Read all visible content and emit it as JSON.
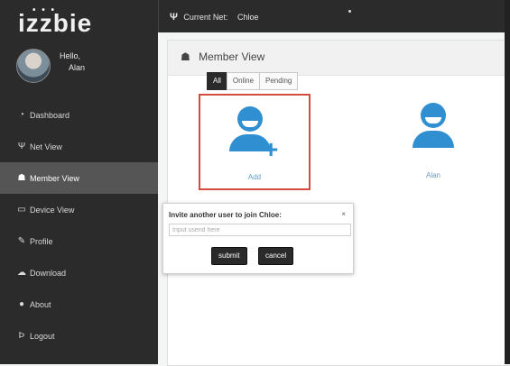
{
  "app": {
    "logo_text": "izzbie",
    "logo_dots": "• • •"
  },
  "profile": {
    "greeting": "Hello,",
    "name": "Alan"
  },
  "nav": {
    "items": [
      {
        "label": "Dashboard",
        "icon": "dashboard-icon",
        "glyph": "◔",
        "active": false
      },
      {
        "label": "Net View",
        "icon": "net-icon",
        "glyph": "Ψ",
        "active": false
      },
      {
        "label": "Member View",
        "icon": "member-icon",
        "glyph": "☗",
        "active": true
      },
      {
        "label": "Device View",
        "icon": "device-icon",
        "glyph": "▭",
        "active": false
      },
      {
        "label": "Profile",
        "icon": "profile-edit-icon",
        "glyph": "✎",
        "active": false
      },
      {
        "label": "Download",
        "icon": "cloud-download-icon",
        "glyph": "☁",
        "active": false
      },
      {
        "label": "About",
        "icon": "info-icon",
        "glyph": "●",
        "active": false
      },
      {
        "label": "Logout",
        "icon": "logout-icon",
        "glyph": "Þ",
        "active": false
      }
    ]
  },
  "topbar": {
    "net_label": "Current Net:",
    "net_value": "Chloe",
    "net_glyph": "Ψ"
  },
  "panel": {
    "title": "Member View",
    "title_glyph": "☗"
  },
  "filters": [
    {
      "label": "All",
      "active": true
    },
    {
      "label": "Online",
      "active": false
    },
    {
      "label": "Pending",
      "active": false
    }
  ],
  "members": {
    "add_label": "Add",
    "add_glyph": "+",
    "users": [
      {
        "name": "Alan"
      }
    ]
  },
  "invite": {
    "title": "Invite another user to join Chloe:",
    "close": "×",
    "placeholder": "Input userid here",
    "submit_label": "submit",
    "cancel_label": "cancel"
  },
  "colors": {
    "accent": "#2f8fd0",
    "highlight_border": "#d44b3e",
    "sidebar_bg": "#2b2b2b",
    "active_nav": "#555555"
  }
}
